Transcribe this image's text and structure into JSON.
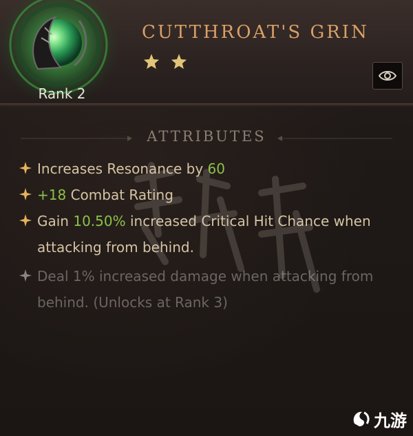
{
  "item": {
    "name": "CUTTHROAT'S GRIN",
    "rank_label": "Rank 2",
    "stars": 2,
    "colors": {
      "title": "#d9a067",
      "highlight_number": "#8ac24a",
      "attribute_text": "#d6c4a4",
      "locked_text": "#6c6662",
      "gem_glow": "#3fbf4a"
    }
  },
  "toolbar": {
    "inspect_icon": "eye-icon"
  },
  "attributes_section": {
    "title": "ATTRIBUTES",
    "items": [
      {
        "pre": "Increases Resonance by ",
        "num": "60",
        "post": "",
        "locked": false
      },
      {
        "pre": "",
        "num": "+18",
        "post": " Combat Rating",
        "locked": false
      },
      {
        "pre": "Gain ",
        "num": "10.50%",
        "post": " increased Critical Hit Chance when attacking from behind.",
        "locked": false
      },
      {
        "pre": "Deal 1% increased damage when attacking from behind. (Unlocks at Rank 3)",
        "num": "",
        "post": "",
        "locked": true
      }
    ]
  },
  "watermark_logo": {
    "text": "九游"
  }
}
